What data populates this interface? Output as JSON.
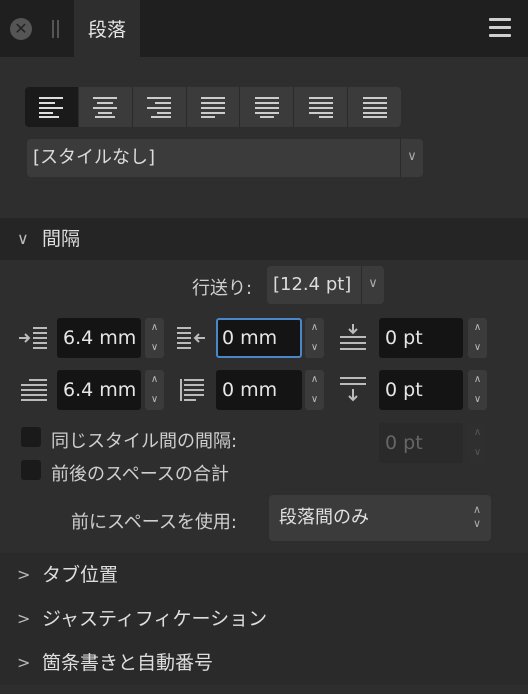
{
  "panel": {
    "tab_title": "段落",
    "close_glyph": "✕"
  },
  "alignment": {
    "options": [
      "align-left",
      "align-center",
      "align-right",
      "justify-left",
      "justify-center",
      "justify-right",
      "justify-all"
    ],
    "selected": "align-left"
  },
  "paragraph_style": {
    "value": "[スタイルなし]"
  },
  "spacing": {
    "header": "間隔",
    "leading_label": "行送り:",
    "leading_value": "[12.4 pt]",
    "left_indent": "6.4 mm",
    "right_indent": "0 mm",
    "space_before": "0 pt",
    "first_line_indent": "6.4 mm",
    "last_line_indent": "0 mm",
    "space_after": "0 pt",
    "same_style_label": "同じスタイル間の間隔:",
    "same_style_value": "0 pt",
    "combine_label": "前後のスペースの合計",
    "use_space_label": "前にスペースを使用:",
    "use_space_value": "段落間のみ"
  },
  "sections": {
    "tabs": "タブ位置",
    "justification": "ジャスティフィケーション",
    "bullets": "箇条書きと自動番号"
  },
  "glyphs": {
    "expanded": "∨",
    "collapsed": ">",
    "dropdown": "∨",
    "up": "∧",
    "down": "∨"
  }
}
